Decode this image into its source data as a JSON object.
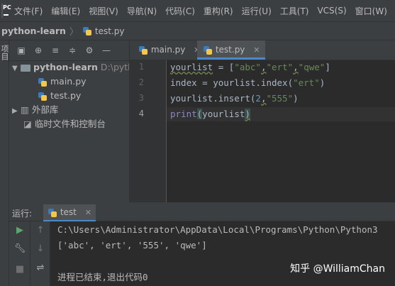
{
  "menubar": {
    "logo_text": "PC",
    "items": [
      "文件(F)",
      "编辑(E)",
      "视图(V)",
      "导航(N)",
      "代码(C)",
      "重构(R)",
      "运行(U)",
      "工具(T)",
      "VCS(S)",
      "窗口(W)"
    ]
  },
  "breadcrumb": {
    "project": "python-learn",
    "file": "test.py"
  },
  "left_strip": {
    "label": "项目"
  },
  "project_tree": {
    "root_name": "python-learn",
    "root_path": "D:\\pyth",
    "files": [
      "main.py",
      "test.py"
    ],
    "external_libs": "外部库",
    "scratches": "临时文件和控制台"
  },
  "editor": {
    "tabs": [
      {
        "label": "main.py",
        "active": false
      },
      {
        "label": "test.py",
        "active": true
      }
    ],
    "line_numbers": [
      "1",
      "2",
      "3",
      "4"
    ],
    "lines": {
      "l1": {
        "var": "yourlist",
        "op": " = [",
        "s1": "\"abc\"",
        "s2": "\"ert\"",
        "s3": "\"qwe\"",
        "end": "]"
      },
      "l2": {
        "pre": "index = yourlist.index(",
        "s": "\"ert\"",
        "end": ")"
      },
      "l3": {
        "pre": "yourlist.insert(",
        "n": "2",
        "s": "\"555\"",
        "end": ")"
      },
      "l4": {
        "fn": "print",
        "arg": "yourlist"
      }
    }
  },
  "run_panel": {
    "label": "运行:",
    "tab": "test",
    "output": [
      "C:\\Users\\Administrator\\AppData\\Local\\Programs\\Python\\Python3",
      "['abc', 'ert', '555', 'qwe']",
      "",
      "进程已结束,退出代码0"
    ]
  },
  "watermark": "知乎 @WilliamChan"
}
